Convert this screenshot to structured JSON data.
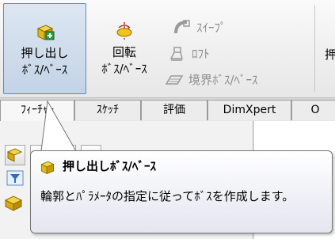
{
  "ribbon": {
    "extrude_button": {
      "line1": "押し出し",
      "line2": "ﾎﾞｽ/ﾍﾞｰｽ",
      "icon": "extrude-boss-icon"
    },
    "revolve_button": {
      "line1": "回転",
      "line2": "ﾎﾞｽ/ﾍﾞｰｽ",
      "icon": "revolve-boss-icon"
    },
    "sweep": {
      "label": "ｽｲｰﾌﾟ",
      "icon": "sweep-icon"
    },
    "loft": {
      "label": "ﾛﾌﾄ",
      "icon": "loft-icon"
    },
    "boundary": {
      "label": "境界ﾎﾞｽ/ﾍﾞｰｽ",
      "icon": "boundary-boss-icon"
    },
    "cut_label": "押"
  },
  "tabs": [
    {
      "label": "ﾌｨｰﾁｬｰ"
    },
    {
      "label": "ｽｹｯﾁ"
    },
    {
      "label": "評価"
    },
    {
      "label": "DimXpert"
    },
    {
      "label": "O"
    }
  ],
  "tooltip": {
    "title": "押し出しﾎﾞｽ/ﾍﾞｰｽ",
    "description": "輪郭とﾊﾟﾗﾒｰﾀの指定に従ってﾎﾞｽを作成します。"
  },
  "colors": {
    "accent": "#5f8bbd",
    "tooltip_border": "#767676"
  }
}
